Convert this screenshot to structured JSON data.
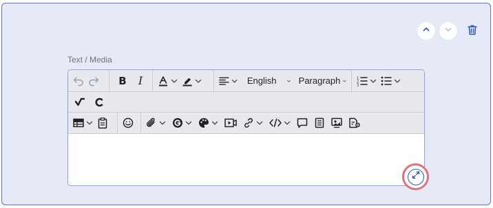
{
  "field": {
    "label": "Text / Media"
  },
  "toolbar": {
    "language_value": "English",
    "block_format_value": "Paragraph"
  },
  "icons": {
    "move_up": "chevron-up-icon",
    "move_down": "chevron-down-icon",
    "delete": "trash-icon",
    "undo": "undo-icon",
    "redo": "redo-icon",
    "bold": "B",
    "italic": "I",
    "font_color": "font-color-icon",
    "highlight": "highlighter-icon",
    "align": "align-left-icon",
    "numbered_list": "numbered-list-icon",
    "bullet_list": "bullet-list-icon",
    "spellcheck": "spellcheck-icon",
    "custom_c": "c-icon",
    "table": "table-icon",
    "paste": "paste-icon",
    "emoji": "emoji-icon",
    "attachment": "paperclip-icon",
    "grammarly": "g-icon",
    "palette": "palette-icon",
    "video": "video-icon",
    "link": "link-icon",
    "code": "code-icon",
    "comment": "comment-icon",
    "notes": "notes-icon",
    "media_review": "media-icon",
    "doc_settings": "doc-settings-icon",
    "expand": "expand-icon"
  },
  "colors": {
    "panel_bg": "#e6eaf6",
    "panel_border": "#5a6fd6",
    "accent": "#2b55c9",
    "highlight_ring": "#e0707a"
  }
}
